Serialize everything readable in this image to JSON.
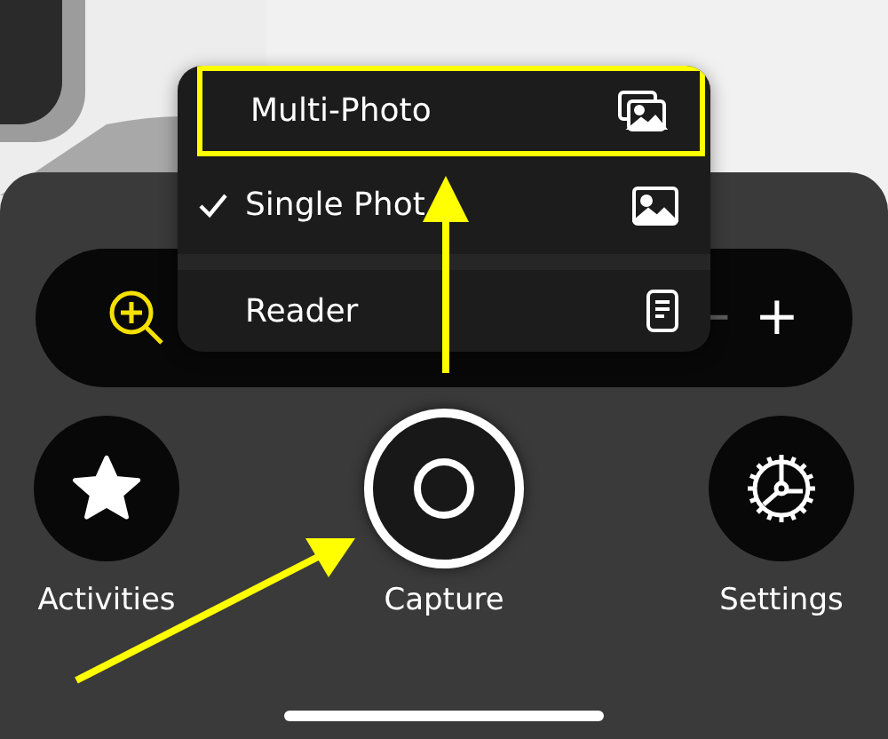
{
  "menu": {
    "items": [
      {
        "label": "Multi-Photo",
        "kind": "multi",
        "selected": false,
        "highlighted": true
      },
      {
        "label": "Single Phot",
        "kind": "single",
        "selected": true,
        "highlighted": false
      },
      {
        "label": "Reader",
        "kind": "reader",
        "selected": false,
        "highlighted": false
      }
    ]
  },
  "zoom_bar": {
    "minus": {
      "label": "−",
      "disabled": true
    },
    "plus": {
      "label": "+",
      "disabled": false
    }
  },
  "actions": [
    {
      "label": "Activities",
      "kind": "star"
    },
    {
      "label": "Capture",
      "kind": "capture"
    },
    {
      "label": "Settings",
      "kind": "gear"
    }
  ]
}
